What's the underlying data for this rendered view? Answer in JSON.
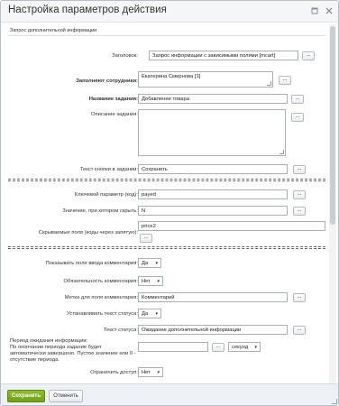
{
  "window": {
    "title": "Настройка параметров действия",
    "icons": [
      "expand-icon",
      "close-icon"
    ]
  },
  "section_title": "Запрос дополнительной информации",
  "fields": {
    "title_label": "Заголовок:",
    "title_value": "Запрос информации с зависимыми полями [mcart]",
    "fill_label": "Заполняют сотрудники:",
    "fill_value": "Екатерина Смирнова [1]",
    "task_name_label": "Название задания:",
    "task_name_value": "Добавление товара",
    "task_desc_label": "Описание задания:",
    "task_desc_value": "",
    "button_text_label": "Текст кнопки в задании:",
    "button_text_value": "Сохранить",
    "key_param_label": "Ключевой параметр (код):",
    "key_param_value": "payed",
    "hide_value_label": "Значение, при котором скрыть:",
    "hide_value_value": "N",
    "hidden_fields_label": "Скрываемые поля (коды через запятую):",
    "hidden_fields_value": "price2",
    "show_comment_label": "Показывать поле ввода комментария:",
    "show_comment_value": "Да",
    "required_comment_label": "Обязательность комментария:",
    "required_comment_value": "Нет",
    "comment_label_label": "Метка для поля комментария:",
    "comment_label_value": "Комментарий",
    "set_status_label": "Устанавливать текст статуса:",
    "set_status_value": "Да",
    "status_text_label": "Текст статуса:",
    "status_text_value": "Ожидание дополнительной информации",
    "wait_period_label": "Период ожидания информации:",
    "wait_period_desc": "По окончании периода задание будет автоматически завершено. Пустое значение или 0 - отсутствие периода.",
    "wait_period_value": "",
    "wait_period_unit": "секунд",
    "restrict_access_label": "Ограничить доступ:",
    "restrict_access_value": "Нет"
  },
  "ui": {
    "dots": "...",
    "dots_short": "...",
    "select_arrow": "▾"
  },
  "footer": {
    "save_label": "Сохранить",
    "cancel_label": "Отменить"
  },
  "colors": {
    "save_button": "#7aa822",
    "border": "#a9b0b6"
  }
}
